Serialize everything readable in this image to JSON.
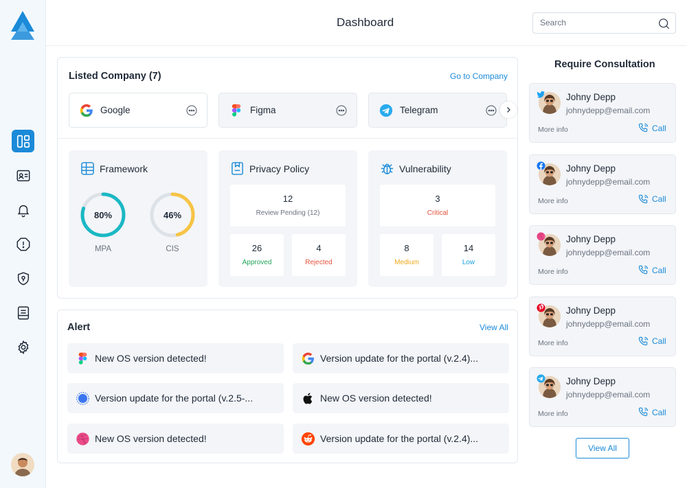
{
  "header": {
    "title": "Dashboard",
    "search_placeholder": "Search"
  },
  "sidebar": {
    "items": [
      {
        "name": "dashboard",
        "icon": "layout-grid-icon",
        "active": true
      },
      {
        "name": "contacts",
        "icon": "id-card-icon",
        "active": false
      },
      {
        "name": "notifications",
        "icon": "bell-icon",
        "active": false
      },
      {
        "name": "alerts",
        "icon": "alert-octagon-icon",
        "active": false
      },
      {
        "name": "security",
        "icon": "shield-pin-icon",
        "active": false
      },
      {
        "name": "documents",
        "icon": "document-icon",
        "active": false
      },
      {
        "name": "settings",
        "icon": "gear-icon",
        "active": false
      }
    ]
  },
  "listed": {
    "title": "Listed Company (7)",
    "link": "Go to Company",
    "companies": [
      {
        "name": "Google",
        "icon": "google-icon"
      },
      {
        "name": "Figma",
        "icon": "figma-icon"
      },
      {
        "name": "Telegram",
        "icon": "telegram-icon"
      }
    ]
  },
  "framework": {
    "title": "Framework",
    "mpa": {
      "value": "80%",
      "label": "MPA",
      "fraction": 0.8,
      "color": "#1bb8c4"
    },
    "cis": {
      "value": "46%",
      "label": "CIS",
      "fraction": 0.46,
      "color": "#f6c445"
    }
  },
  "privacy": {
    "title": "Privacy Policy",
    "pending": {
      "num": "12",
      "label": "Review Pending (12)"
    },
    "approved": {
      "num": "26",
      "label": "Approved",
      "color": "#22a55b"
    },
    "rejected": {
      "num": "4",
      "label": "Rejected",
      "color": "#e5533d"
    }
  },
  "vuln": {
    "title": "Vulnerability",
    "critical": {
      "num": "3",
      "label": "Critical",
      "color": "#e5533d"
    },
    "medium": {
      "num": "8",
      "label": "Medium",
      "color": "#f0a81c"
    },
    "low": {
      "num": "14",
      "label": "Low",
      "color": "#1ba3e3"
    }
  },
  "alert": {
    "title": "Alert",
    "link": "View All",
    "items": [
      {
        "text": "New OS version detected!",
        "icon": "figma-icon"
      },
      {
        "text": "Version update for the portal (v.2.4)...",
        "icon": "google-icon"
      },
      {
        "text": "Version update for the portal (v.2.5-...",
        "icon": "signal-icon"
      },
      {
        "text": "New OS version detected!",
        "icon": "apple-icon"
      },
      {
        "text": "New OS version detected!",
        "icon": "dribbble-icon"
      },
      {
        "text": "Version update for the portal (v.2.4)...",
        "icon": "reddit-icon"
      }
    ]
  },
  "consult": {
    "title": "Require Consultation",
    "view_all": "View All",
    "people": [
      {
        "name": "Johny Depp",
        "email": "johnydepp@email.com",
        "more": "More info",
        "call": "Call",
        "social": "twitter-icon"
      },
      {
        "name": "Johny Depp",
        "email": "johnydepp@email.com",
        "more": "More info",
        "call": "Call",
        "social": "facebook-icon"
      },
      {
        "name": "Johny Depp",
        "email": "johnydepp@email.com",
        "more": "More info",
        "call": "Call",
        "social": "dribbble-icon"
      },
      {
        "name": "Johny Depp",
        "email": "johnydepp@email.com",
        "more": "More info",
        "call": "Call",
        "social": "pinterest-icon"
      },
      {
        "name": "Johny Depp",
        "email": "johnydepp@email.com",
        "more": "More info",
        "call": "Call",
        "social": "telegram-icon"
      }
    ]
  }
}
